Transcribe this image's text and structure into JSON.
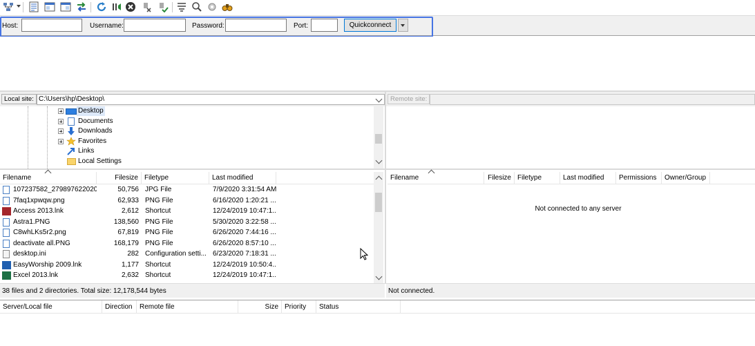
{
  "toolbar": {
    "icons": [
      "site-manager-icon",
      "toggle-message-log-icon",
      "toggle-local-tree-icon",
      "toggle-remote-tree-icon",
      "toggle-transfer-queue-icon",
      "refresh-icon",
      "process-queue-icon",
      "cancel-icon",
      "disconnect-icon",
      "reconnect-icon",
      "directory-filter-icon",
      "compare-icon",
      "sync-browse-icon",
      "search-icon"
    ]
  },
  "quickconnect": {
    "host_label": "Host:",
    "username_label": "Username:",
    "password_label": "Password:",
    "port_label": "Port:",
    "host_value": "",
    "username_value": "",
    "password_value": "",
    "port_value": "",
    "button_label": "Quickconnect",
    "highlight_color": "#4674e4"
  },
  "local_site": {
    "label": "Local site:",
    "path": "C:\\Users\\hp\\Desktop\\",
    "tree": [
      {
        "label": "Desktop",
        "icon": "desktop-folder-icon",
        "selected": true
      },
      {
        "label": "Documents",
        "icon": "documents-folder-icon"
      },
      {
        "label": "Downloads",
        "icon": "downloads-folder-icon"
      },
      {
        "label": "Favorites",
        "icon": "favorites-folder-icon"
      },
      {
        "label": "Links",
        "icon": "links-folder-icon"
      },
      {
        "label": "Local Settings",
        "icon": "folder-icon"
      }
    ]
  },
  "remote_site": {
    "label": "Remote site:",
    "path": ""
  },
  "local_list": {
    "columns": [
      "Filename",
      "Filesize",
      "Filetype",
      "Last modified"
    ],
    "rows": [
      {
        "name": "107237582_2798976220207...",
        "size": "50,756",
        "type": "JPG File",
        "modified": "7/9/2020 3:31:54 AM",
        "icon": "image-file-icon"
      },
      {
        "name": "7faq1xpwqw.png",
        "size": "62,933",
        "type": "PNG File",
        "modified": "6/16/2020 1:20:21 ...",
        "icon": "image-file-icon"
      },
      {
        "name": "Access 2013.lnk",
        "size": "2,612",
        "type": "Shortcut",
        "modified": "12/24/2019 10:47:1...",
        "icon": "access-icon"
      },
      {
        "name": "Astra1.PNG",
        "size": "138,560",
        "type": "PNG File",
        "modified": "5/30/2020 3:22:58 ...",
        "icon": "image-file-icon"
      },
      {
        "name": "C8whLKs5r2.png",
        "size": "67,819",
        "type": "PNG File",
        "modified": "6/26/2020 7:44:16 ...",
        "icon": "image-file-icon"
      },
      {
        "name": "deactivate all.PNG",
        "size": "168,179",
        "type": "PNG File",
        "modified": "6/26/2020 8:57:10 ...",
        "icon": "image-file-icon"
      },
      {
        "name": "desktop.ini",
        "size": "282",
        "type": "Configuration setti...",
        "modified": "6/23/2020 7:18:31 ...",
        "icon": "config-file-icon"
      },
      {
        "name": "EasyWorship 2009.lnk",
        "size": "1,177",
        "type": "Shortcut",
        "modified": "12/24/2019 10:50:4...",
        "icon": "easyworship-icon"
      },
      {
        "name": "Excel 2013.lnk",
        "size": "2,632",
        "type": "Shortcut",
        "modified": "12/24/2019 10:47:1...",
        "icon": "excel-icon"
      }
    ],
    "status": "38 files and 2 directories. Total size: 12,178,544 bytes"
  },
  "remote_list": {
    "columns": [
      "Filename",
      "Filesize",
      "Filetype",
      "Last modified",
      "Permissions",
      "Owner/Group"
    ],
    "empty_message": "Not connected to any server",
    "status": "Not connected."
  },
  "queue": {
    "columns": [
      "Server/Local file",
      "Direction",
      "Remote file",
      "Size",
      "Priority",
      "Status"
    ]
  }
}
